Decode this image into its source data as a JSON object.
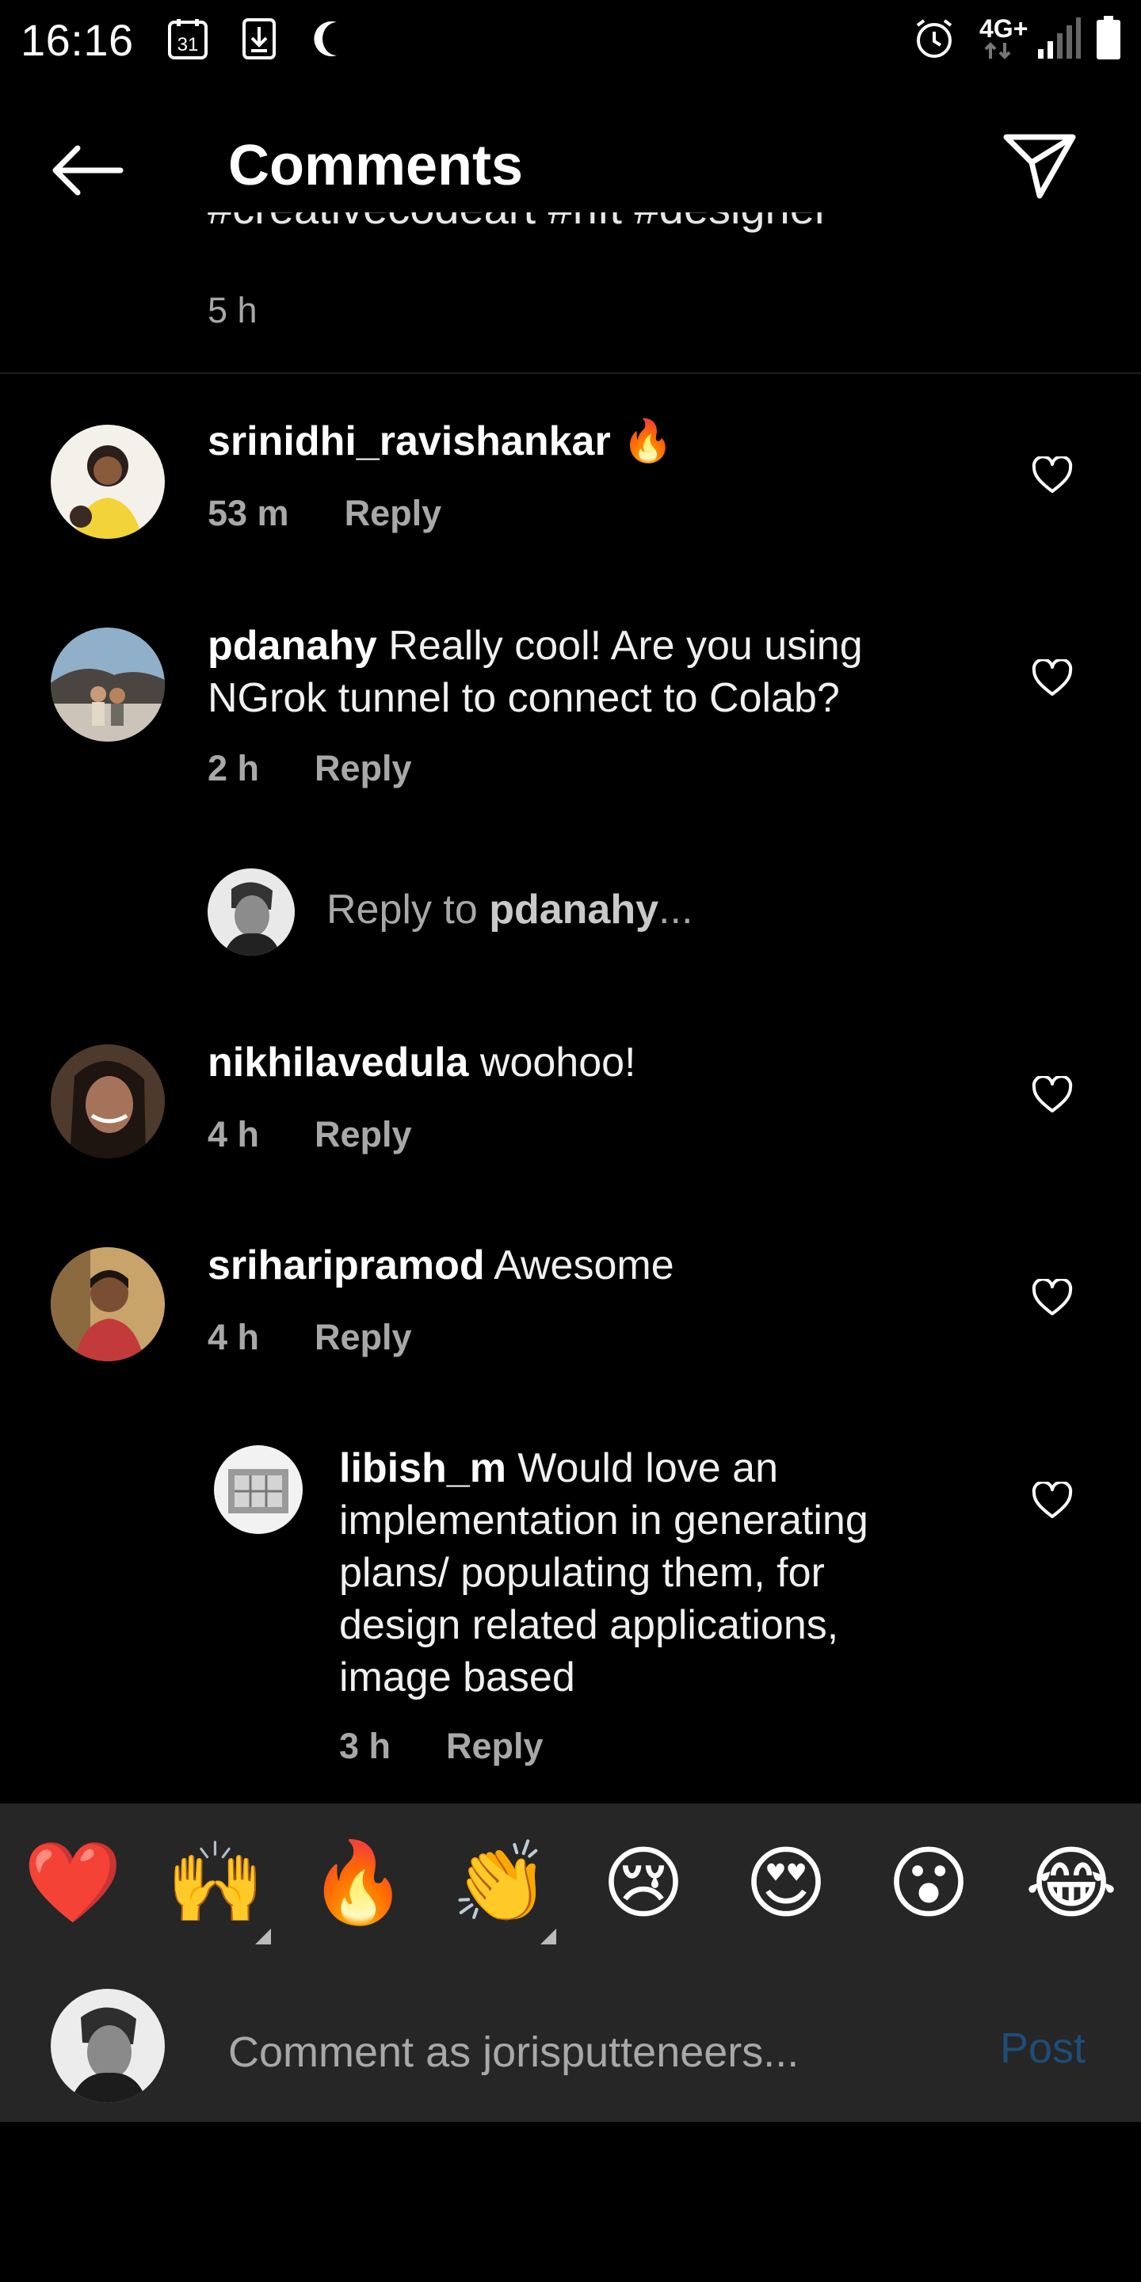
{
  "status_bar": {
    "time": "16:16",
    "calendar_day": "31",
    "network": "4G+",
    "icons": [
      "calendar-icon",
      "download-icon",
      "moon-icon",
      "alarm-icon",
      "signal-icon",
      "battery-icon"
    ]
  },
  "header": {
    "title": "Comments",
    "back_icon": "arrow-left-icon",
    "share_icon": "paper-plane-icon"
  },
  "caption": {
    "fragment": "#creativecodeart #nft #designer",
    "time": "5 h"
  },
  "comments": [
    {
      "username": "srinidhi_ravishankar",
      "text": "🔥",
      "time": "53 m",
      "reply": "Reply"
    },
    {
      "username": "pdanahy",
      "text": "Really cool! Are you using NGrok tunnel to connect to Colab?",
      "time": "2 h",
      "reply": "Reply"
    },
    {
      "username": "nikhilavedula",
      "text": "woohoo!",
      "time": "4 h",
      "reply": "Reply"
    },
    {
      "username": "sriharipramod",
      "text": "Awesome",
      "time": "4 h",
      "reply": "Reply"
    },
    {
      "username": "libish_m",
      "text": "Would love an implementation in generating plans/ populating them, for design related applications, image based",
      "time": "3 h",
      "reply": "Reply"
    }
  ],
  "reply_prompt": {
    "prefix": "Reply to ",
    "user": "pdanahy",
    "suffix": "..."
  },
  "emoji_bar": {
    "emojis": [
      "❤️",
      "🙌",
      "🔥",
      "👏",
      "😢",
      "😍",
      "😮",
      "😂"
    ]
  },
  "composer": {
    "placeholder": "Comment as jorisputteneers...",
    "post_label": "Post"
  },
  "colors": {
    "background": "#000000",
    "secondary_text": "#a8a8a8",
    "bar_background": "#262626",
    "post_disabled": "#1d4d78"
  }
}
